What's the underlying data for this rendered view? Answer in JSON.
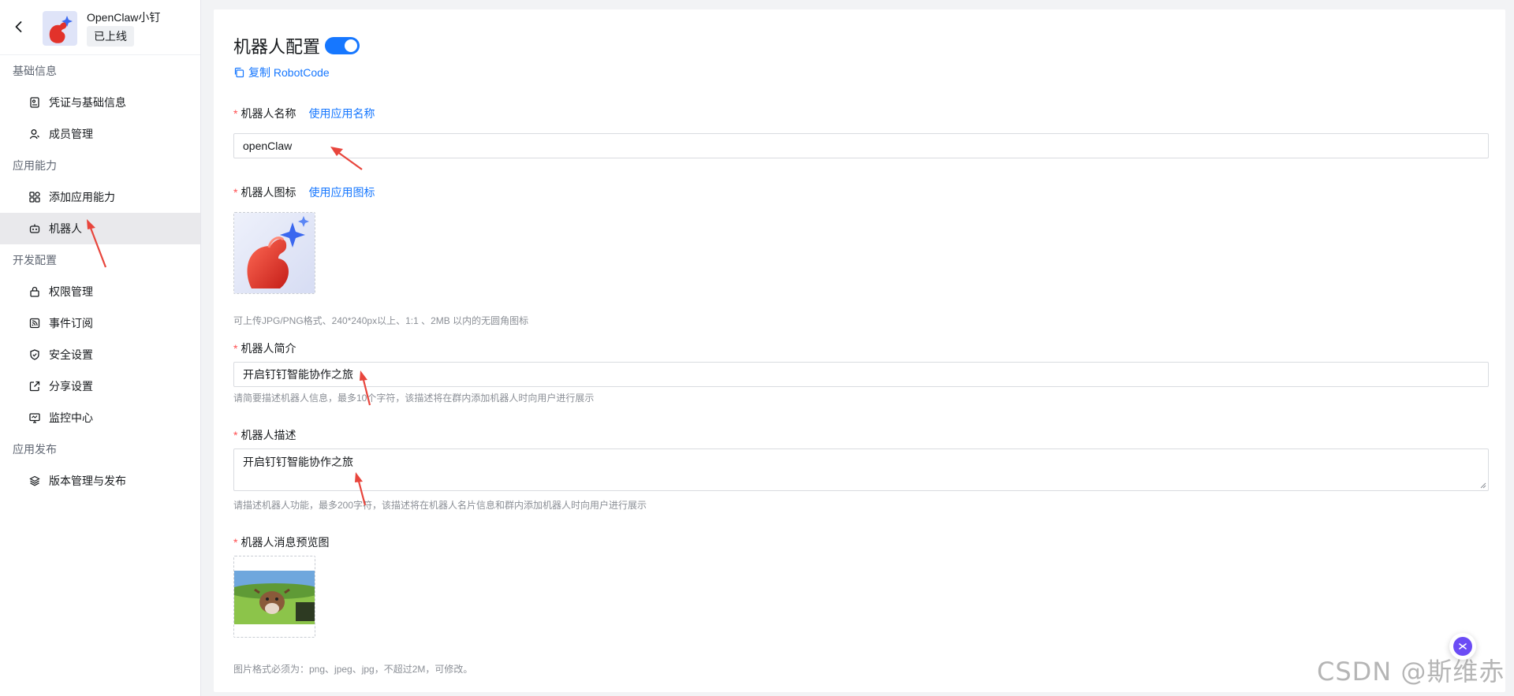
{
  "app": {
    "name": "OpenClaw小钉",
    "status": "已上线"
  },
  "sidebar": {
    "groups": [
      {
        "label": "基础信息",
        "items": [
          {
            "label": "凭证与基础信息",
            "icon": "credential-icon"
          },
          {
            "label": "成员管理",
            "icon": "user-icon"
          }
        ]
      },
      {
        "label": "应用能力",
        "items": [
          {
            "label": "添加应用能力",
            "icon": "apps-icon"
          },
          {
            "label": "机器人",
            "icon": "robot-icon",
            "active": true
          }
        ]
      },
      {
        "label": "开发配置",
        "items": [
          {
            "label": "权限管理",
            "icon": "lock-icon"
          },
          {
            "label": "事件订阅",
            "icon": "rss-icon"
          },
          {
            "label": "安全设置",
            "icon": "shield-icon"
          },
          {
            "label": "分享设置",
            "icon": "share-icon"
          },
          {
            "label": "监控中心",
            "icon": "monitor-icon"
          }
        ]
      },
      {
        "label": "应用发布",
        "items": [
          {
            "label": "版本管理与发布",
            "icon": "layers-icon"
          }
        ]
      }
    ]
  },
  "main": {
    "title": "机器人配置",
    "toggle_on": true,
    "copy_link": "复制 RobotCode",
    "name_field": {
      "label": "机器人名称",
      "link": "使用应用名称",
      "value": "openClaw"
    },
    "icon_field": {
      "label": "机器人图标",
      "link": "使用应用图标",
      "hint": "可上传JPG/PNG格式、240*240px以上、1:1 、2MB 以内的无圆角图标"
    },
    "intro_field": {
      "label": "机器人简介",
      "value": "开启钉钉智能协作之旅",
      "hint": "请简要描述机器人信息，最多10个字符，该描述将在群内添加机器人时向用户进行展示"
    },
    "desc_field": {
      "label": "机器人描述",
      "value": "开启钉钉智能协作之旅",
      "hint": "请描述机器人功能，最多200字符，该描述将在机器人名片信息和群内添加机器人时向用户进行展示"
    },
    "preview_field": {
      "label": "机器人消息预览图",
      "hint": "图片格式必须为：png、jpeg、jpg，不超过2M，可修改。"
    }
  },
  "watermark": "CSDN @斯维赤",
  "colors": {
    "accent": "#1677ff",
    "required": "#ff4d4f",
    "annotation_arrow": "#e8453c"
  }
}
